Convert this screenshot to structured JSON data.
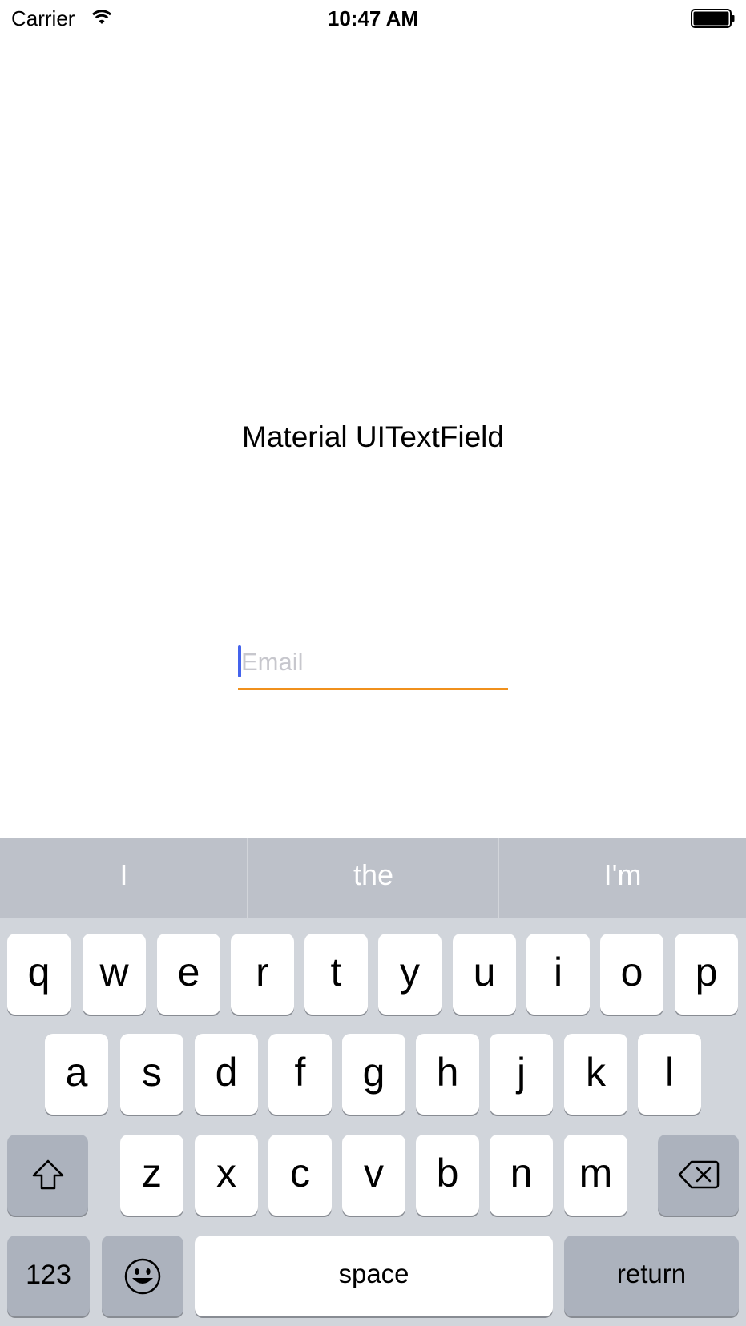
{
  "status_bar": {
    "carrier": "Carrier",
    "time": "10:47 AM",
    "wifi_icon": "wifi-icon",
    "battery_icon": "battery-icon"
  },
  "main": {
    "title": "Material UITextField",
    "email_field": {
      "placeholder": "Email",
      "value": "",
      "underline_color": "#f0901c",
      "caret_color": "#4463ec"
    }
  },
  "keyboard": {
    "suggestions": [
      "I",
      "the",
      "I'm"
    ],
    "row1": [
      "q",
      "w",
      "e",
      "r",
      "t",
      "y",
      "u",
      "i",
      "o",
      "p"
    ],
    "row2": [
      "a",
      "s",
      "d",
      "f",
      "g",
      "h",
      "j",
      "k",
      "l"
    ],
    "row3": [
      "z",
      "x",
      "c",
      "v",
      "b",
      "n",
      "m"
    ],
    "numbers_label": "123",
    "space_label": "space",
    "return_label": "return",
    "shift_icon": "shift-icon",
    "delete_icon": "delete-icon",
    "emoji_icon": "emoji-icon"
  }
}
